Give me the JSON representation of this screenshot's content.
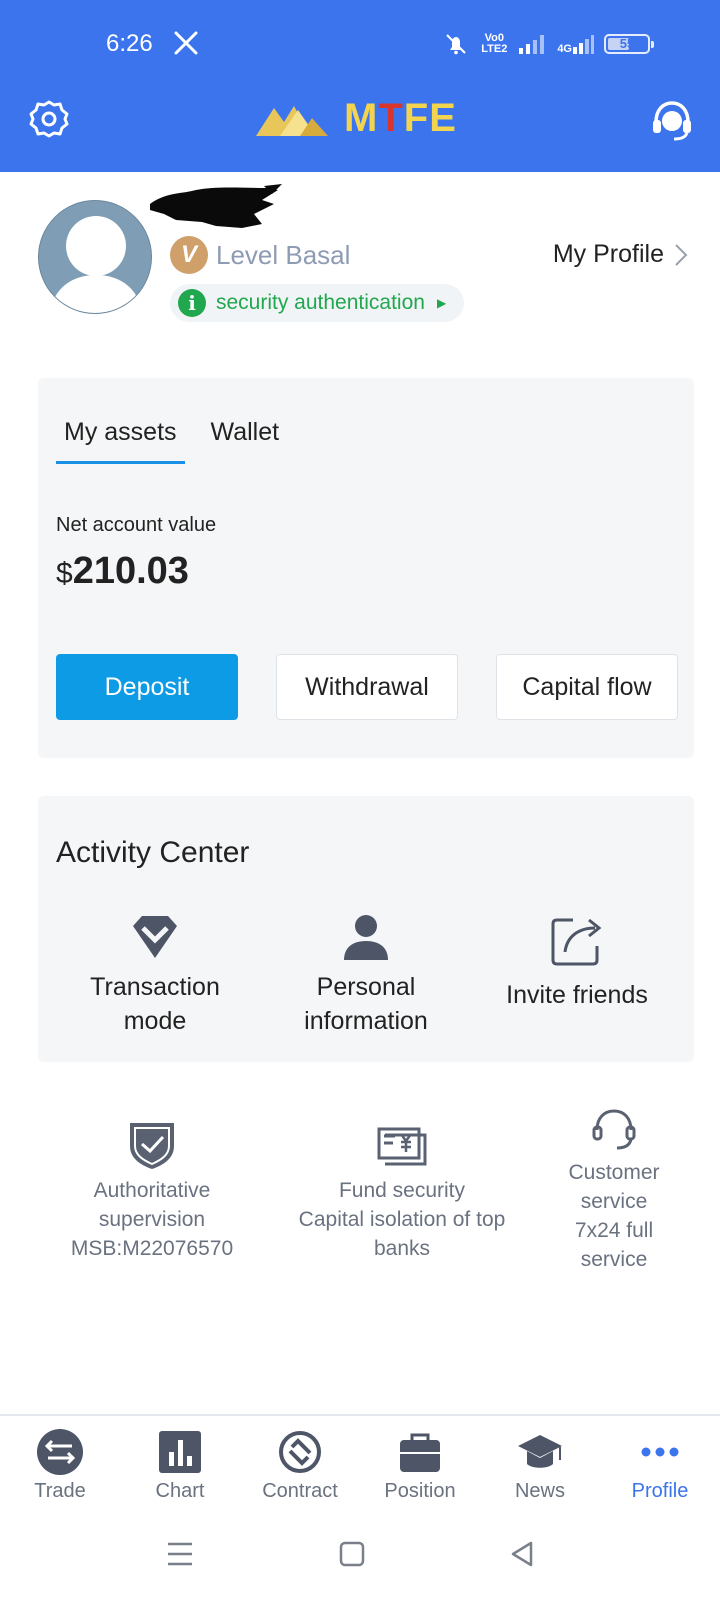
{
  "status_bar": {
    "time": "6:26",
    "network_tag_top": "Vo0",
    "network_tag_bottom": "LTE2",
    "data_tag": "4G",
    "battery": "55",
    "battery_level": 0.55
  },
  "header": {
    "brand_prefix": "M",
    "brand_t": "T",
    "brand_suffix": "FE",
    "icons": [
      "gear-icon",
      "headset-icon"
    ]
  },
  "profile": {
    "level_badge": "V",
    "level": "Level Basal",
    "my_profile": "My Profile",
    "security_icon": "i",
    "security": "security authentication",
    "security_arrow": "▶"
  },
  "assets": {
    "tabs": [
      {
        "label": "My assets",
        "active": true
      },
      {
        "label": "Wallet",
        "active": false
      }
    ],
    "net_label": "Net account value",
    "currency": "$",
    "net_value": "210.03",
    "buttons": {
      "deposit": "Deposit",
      "withdrawal": "Withdrawal",
      "capital_flow": "Capital flow"
    }
  },
  "activity": {
    "title": "Activity Center",
    "items": [
      {
        "line1": "Transaction",
        "line2": "mode",
        "icon": "diamond-icon"
      },
      {
        "line1": "Personal",
        "line2": "information",
        "icon": "person-icon"
      },
      {
        "line1": "Invite friends",
        "line2": "",
        "icon": "share-icon"
      }
    ]
  },
  "features": [
    {
      "line1": "Authoritative",
      "line2": "supervision",
      "line3": "MSB:M22076570",
      "line4": "",
      "icon": "shield-check-icon"
    },
    {
      "line1": "Fund security",
      "line2": "Capital isolation of top",
      "line3": "banks",
      "line4": "",
      "icon": "yuan-card-icon"
    },
    {
      "line1": "Customer",
      "line2": "service",
      "line3": "7x24 full",
      "line4": "service",
      "icon": "headphones-icon"
    }
  ],
  "bottom_nav": [
    {
      "label": "Trade",
      "icon": "swap-icon",
      "active": false
    },
    {
      "label": "Chart",
      "icon": "bar-chart-icon",
      "active": false
    },
    {
      "label": "Contract",
      "icon": "contract-icon",
      "active": false
    },
    {
      "label": "Position",
      "icon": "briefcase-icon",
      "active": false
    },
    {
      "label": "News",
      "icon": "graduation-cap-icon",
      "active": false
    },
    {
      "label": "Profile",
      "icon": "more-dots-icon",
      "active": true
    }
  ],
  "colors": {
    "header_blue": "#3c74ee",
    "accent_blue": "#0e9be6",
    "success_green": "#21a74e",
    "brand_gold": "#f3d44f",
    "brand_red": "#d8362d"
  }
}
